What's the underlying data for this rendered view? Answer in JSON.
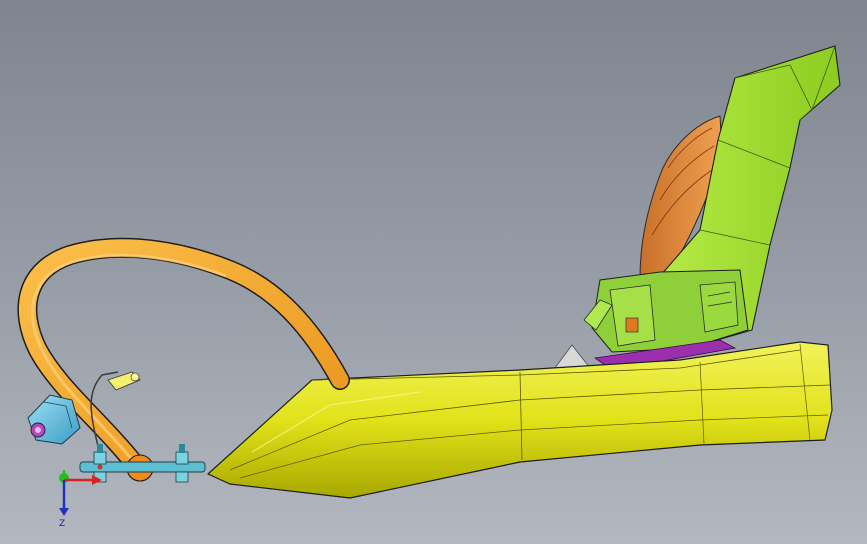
{
  "viewport": {
    "background_top": "#7f858e",
    "background_bottom": "#b3b8c0"
  },
  "colors": {
    "base_yellow": "#e8e81a",
    "base_yellow_dark": "#b8b800",
    "upright_green": "#a8e030",
    "hoop_orange": "#f5a623",
    "back_orange": "#e08a3a",
    "accent_purple": "#9b2fae",
    "accent_cyan": "#4fb8d8",
    "edge_dark": "#202020"
  },
  "icons": {
    "triad": "xyz-axis-triad-icon"
  },
  "triad": {
    "z_label": "Z",
    "x_color": "#e02020",
    "y_color": "#20c020",
    "z_color": "#2030c0"
  }
}
